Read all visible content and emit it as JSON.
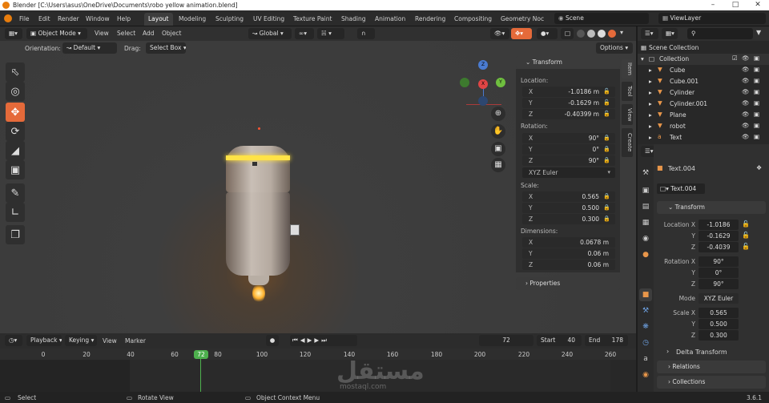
{
  "title": "Blender [C:\\Users\\asus\\OneDrive\\Documents\\robo yellow animation.blend]",
  "menus": [
    "File",
    "Edit",
    "Render",
    "Window",
    "Help"
  ],
  "workspaces": [
    "Layout",
    "Modeling",
    "Sculpting",
    "UV Editing",
    "Texture Paint",
    "Shading",
    "Animation",
    "Rendering",
    "Compositing",
    "Geometry Noc"
  ],
  "scene": "Scene",
  "view_layer": "ViewLayer",
  "header": {
    "mode": "Object Mode",
    "menus": [
      "View",
      "Select",
      "Add",
      "Object"
    ],
    "transform": "Global"
  },
  "toolsettings": {
    "orientation_label": "Orientation:",
    "orientation": "Default",
    "drag_label": "Drag:",
    "drag": "Select Box",
    "options": "Options"
  },
  "gizmo": {
    "z": "Z",
    "y": "Y",
    "x": "X"
  },
  "npanel": {
    "transform_title": "Transform",
    "location_label": "Location:",
    "location": {
      "x": "-1.0186 m",
      "y": "-0.1629 m",
      "z": "-0.40399 m"
    },
    "rotation_label": "Rotation:",
    "rotation": {
      "x": "90°",
      "y": "0°",
      "z": "90°"
    },
    "rotation_mode": "XYZ Euler",
    "scale_label": "Scale:",
    "scale": {
      "x": "0.565",
      "y": "0.500",
      "z": "0.300"
    },
    "dimensions_label": "Dimensions:",
    "dimensions": {
      "x": "0.0678 m",
      "y": "0.06 m",
      "z": "0.06 m"
    },
    "properties_title": "Properties",
    "tabs": [
      "Item",
      "Tool",
      "View",
      "Create"
    ]
  },
  "timeline": {
    "playback": "Playback",
    "keying": "Keying",
    "view": "View",
    "marker": "Marker",
    "current_frame": "72",
    "start_label": "Start",
    "start": "40",
    "end_label": "End",
    "end": "178",
    "ticks": [
      "0",
      "20",
      "40",
      "60",
      "80",
      "100",
      "120",
      "140",
      "160",
      "180",
      "200",
      "220",
      "240",
      "260"
    ],
    "cursor": "72"
  },
  "status": {
    "select": "Select",
    "rotate": "Rotate View",
    "context": "Object Context Menu",
    "version": "3.6.1"
  },
  "outliner": {
    "title": "Scene Collection",
    "collection": "Collection",
    "items": [
      "Cube",
      "Cube.001",
      "Cylinder",
      "Cylinder.001",
      "Plane",
      "robot",
      "Text"
    ]
  },
  "properties": {
    "object_name": "Text.004",
    "data_name": "Text.004",
    "transform_title": "Transform",
    "location_label": "Location X",
    "loc": [
      "-1.0186",
      "-0.1629",
      "-0.4039"
    ],
    "rotation_label": "Rotation X",
    "rot": [
      "90°",
      "0°",
      "90°"
    ],
    "mode_label": "Mode",
    "mode": "XYZ Euler",
    "scale_label": "Scale X",
    "scl": [
      "0.565",
      "0.500",
      "0.300"
    ],
    "y": "Y",
    "z": "Z",
    "delta": "Delta Transform",
    "relations": "Relations",
    "collections": "Collections"
  },
  "watermark": "mostaql.com",
  "colors": {
    "accent": "#e56a3a",
    "header": "#303030",
    "panel": "#3b3b3b",
    "active_ws": "#3d3d3d"
  }
}
